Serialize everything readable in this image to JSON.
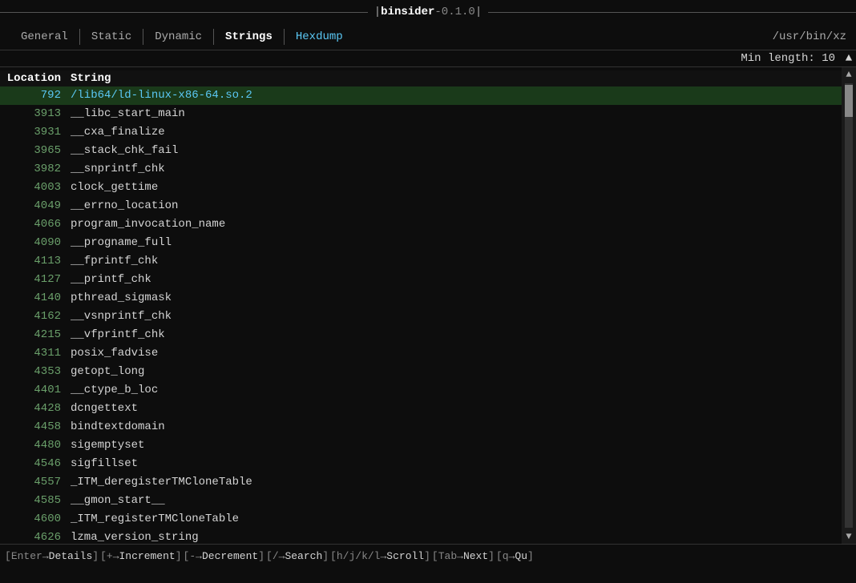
{
  "titleBar": {
    "appName": "binsider",
    "version": "-0.1.0"
  },
  "nav": {
    "tabs": [
      {
        "label": "General",
        "active": false,
        "accent": false
      },
      {
        "label": "Static",
        "active": false,
        "accent": false
      },
      {
        "label": "Dynamic",
        "active": false,
        "accent": false
      },
      {
        "label": "Strings",
        "active": true,
        "accent": false
      },
      {
        "label": "Hexdump",
        "active": false,
        "accent": true
      }
    ],
    "path": "/usr/bin/xz"
  },
  "minLength": {
    "label": "Min length:",
    "value": "10"
  },
  "tableHeader": {
    "location": "Location",
    "string": "String"
  },
  "rows": [
    {
      "location": "792",
      "string": "/lib64/ld-linux-x86-64.so.2",
      "selected": true
    },
    {
      "location": "3913",
      "string": "__libc_start_main",
      "selected": false
    },
    {
      "location": "3931",
      "string": "__cxa_finalize",
      "selected": false
    },
    {
      "location": "3965",
      "string": "__stack_chk_fail",
      "selected": false
    },
    {
      "location": "3982",
      "string": "__snprintf_chk",
      "selected": false
    },
    {
      "location": "4003",
      "string": "clock_gettime",
      "selected": false
    },
    {
      "location": "4049",
      "string": "__errno_location",
      "selected": false
    },
    {
      "location": "4066",
      "string": "program_invocation_name",
      "selected": false
    },
    {
      "location": "4090",
      "string": "__progname_full",
      "selected": false
    },
    {
      "location": "4113",
      "string": "__fprintf_chk",
      "selected": false
    },
    {
      "location": "4127",
      "string": "__printf_chk",
      "selected": false
    },
    {
      "location": "4140",
      "string": "pthread_sigmask",
      "selected": false
    },
    {
      "location": "4162",
      "string": "__vsnprintf_chk",
      "selected": false
    },
    {
      "location": "4215",
      "string": "__vfprintf_chk",
      "selected": false
    },
    {
      "location": "4311",
      "string": "posix_fadvise",
      "selected": false
    },
    {
      "location": "4353",
      "string": "getopt_long",
      "selected": false
    },
    {
      "location": "4401",
      "string": "__ctype_b_loc",
      "selected": false
    },
    {
      "location": "4428",
      "string": "dcngettext",
      "selected": false
    },
    {
      "location": "4458",
      "string": "bindtextdomain",
      "selected": false
    },
    {
      "location": "4480",
      "string": "sigemptyset",
      "selected": false
    },
    {
      "location": "4546",
      "string": "sigfillset",
      "selected": false
    },
    {
      "location": "4557",
      "string": "_ITM_deregisterTMCloneTable",
      "selected": false
    },
    {
      "location": "4585",
      "string": "__gmon_start__",
      "selected": false
    },
    {
      "location": "4600",
      "string": "_ITM_registerTMCloneTable",
      "selected": false
    },
    {
      "location": "4626",
      "string": "lzma_version_string",
      "selected": false
    }
  ],
  "statusBar": {
    "items": [
      {
        "key": "Enter",
        "arrow": "→",
        "label": "Details"
      },
      {
        "key": "+",
        "arrow": "→",
        "label": "Increment"
      },
      {
        "key": "-",
        "arrow": "→",
        "label": "Decrement"
      },
      {
        "key": "/",
        "arrow": "→",
        "label": "Search"
      },
      {
        "key": "h/j/k/l",
        "arrow": "→",
        "label": "Scroll"
      },
      {
        "key": "Tab",
        "arrow": "→",
        "label": "Next"
      },
      {
        "key": "q",
        "arrow": "→",
        "label": "Qu"
      }
    ]
  }
}
